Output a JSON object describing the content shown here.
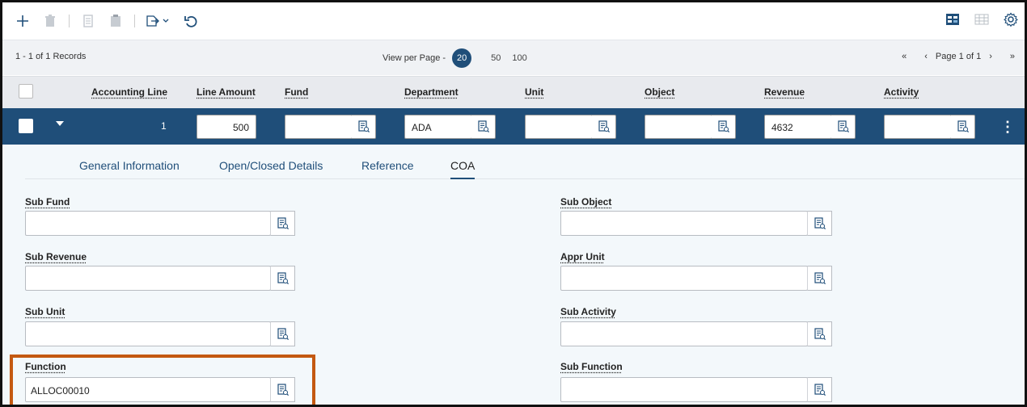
{
  "toolbar": {
    "icons": [
      "add-icon",
      "delete-icon",
      "copy-icon",
      "paste-icon",
      "export-icon",
      "undo-icon"
    ],
    "right_icons": [
      "column-view-icon",
      "grid-view-icon",
      "settings-icon"
    ]
  },
  "records": {
    "count_text": "1 - 1 of 1 Records",
    "view_per_page_label": "View per Page -",
    "per_page_active": "20",
    "per_page_options": [
      "50",
      "100"
    ],
    "pager": {
      "first": "«",
      "prev": "‹",
      "page_text": "Page 1 of 1",
      "next": "›",
      "last": "»"
    }
  },
  "table": {
    "headers": {
      "accounting_line": "Accounting Line",
      "line_amount": "Line Amount",
      "fund": "Fund",
      "department": "Department",
      "unit": "Unit",
      "object": "Object",
      "revenue": "Revenue",
      "activity": "Activity"
    },
    "row": {
      "line_number": "1",
      "line_amount": "500",
      "fund": "",
      "department": "ADA",
      "unit": "",
      "object": "",
      "revenue": "4632",
      "activity": ""
    }
  },
  "tabs": {
    "general": "General Information",
    "open_closed": "Open/Closed Details",
    "reference": "Reference",
    "coa": "COA",
    "active": "COA"
  },
  "fields": {
    "sub_fund": {
      "label": "Sub Fund",
      "value": ""
    },
    "sub_object": {
      "label": "Sub Object",
      "value": ""
    },
    "sub_revenue": {
      "label": "Sub Revenue",
      "value": ""
    },
    "appr_unit": {
      "label": "Appr Unit",
      "value": ""
    },
    "sub_unit": {
      "label": "Sub Unit",
      "value": ""
    },
    "sub_activity": {
      "label": "Sub Activity",
      "value": ""
    },
    "function": {
      "label": "Function",
      "value": "ALLOC00010"
    },
    "sub_function": {
      "label": "Sub Function",
      "value": ""
    }
  },
  "colors": {
    "primary": "#1f4e79",
    "highlight": "#c45911",
    "detail_bg": "#f3f8fb"
  }
}
